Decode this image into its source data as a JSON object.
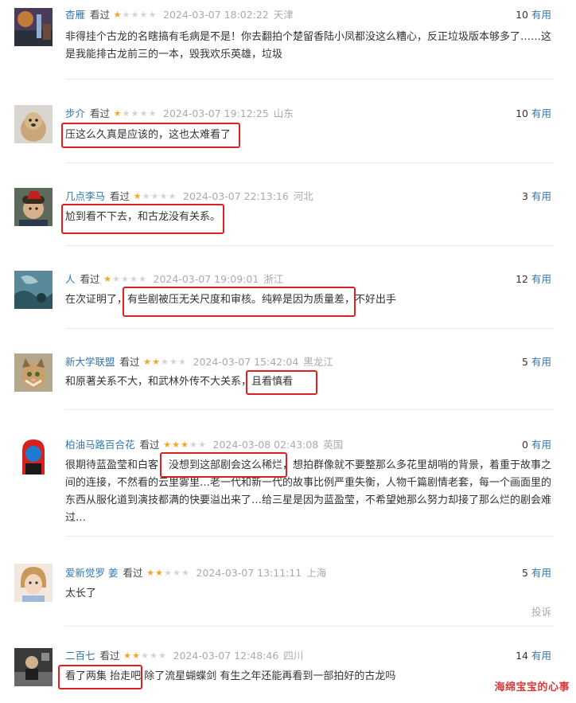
{
  "watched_label": "看过",
  "useful_label": "有用",
  "report_label": "投诉",
  "watermark": "海绵宝宝的心事",
  "comments": [
    {
      "user": "杳雁",
      "stars": 1,
      "time": "2024-03-07 18:02:22",
      "location": "天津",
      "useful": "10",
      "text": "非得挂个古龙的名瞎搞有毛病是不是！你去翻拍个楚留香陆小凤都没这么糟心，反正垃圾版本够多了……这是我能排古龙前三的一本，毁我欢乐英雄，垃圾"
    },
    {
      "user": "步介",
      "stars": 1,
      "time": "2024-03-07 19:12:25",
      "location": "山东",
      "useful": "10",
      "text": "压这么久真是应该的，这也太难看了"
    },
    {
      "user": "几点李马",
      "stars": 1,
      "time": "2024-03-07 22:13:16",
      "location": "河北",
      "useful": "3",
      "text": "尬到看不下去，和古龙没有关系。"
    },
    {
      "user": "人",
      "stars": 1,
      "time": "2024-03-07 19:09:01",
      "location": "浙江",
      "useful": "12",
      "text": "在次证明了，有些剧被压无关尺度和审核。纯粹是因为质量差，不好出手"
    },
    {
      "user": "新大学联盟",
      "stars": 2,
      "time": "2024-03-07 15:42:04",
      "location": "黑龙江",
      "useful": "5",
      "text": "和原著关系不大，和武林外传不大关系，且看慎看"
    },
    {
      "user": "柏油马路百合花",
      "stars": 3,
      "time": "2024-03-08 02:43:08",
      "location": "英国",
      "useful": "0",
      "text": "很期待蓝盈莹和白客，没想到这部剧会这么稀烂，想拍群像就不要整那么多花里胡哨的背景，着重于故事之间的连接，不然看的云里雾里…老一代和新一代的故事比例严重失衡，人物千篇剧情老套，每一个画面里的东西从服化道到演技都满的快要溢出来了…给三星是因为蓝盈莹，不希望她那么努力却接了那么烂的剧会难过…"
    },
    {
      "user": "爱新觉罗 姜",
      "stars": 2,
      "time": "2024-03-07 13:11:11",
      "location": "上海",
      "useful": "5",
      "text": "太长了"
    },
    {
      "user": "二百七",
      "stars": 2,
      "time": "2024-03-07 12:48:46",
      "location": "四川",
      "useful": "14",
      "text": "看了两集 抬走吧 除了流星蝴蝶剑 有生之年还能再看到一部拍好的古龙吗"
    }
  ]
}
